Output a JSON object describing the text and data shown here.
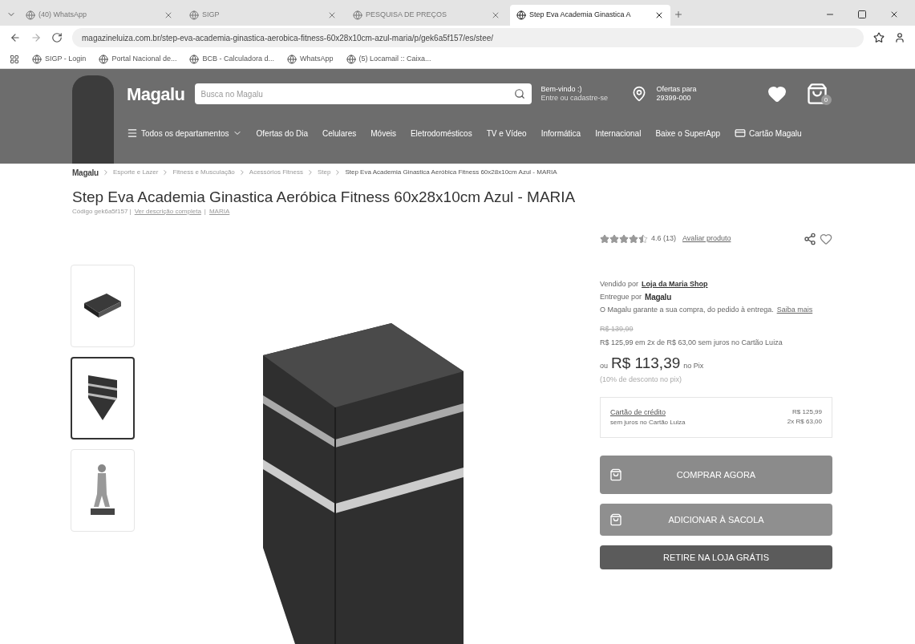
{
  "browser": {
    "tabs": [
      {
        "title": "(40) WhatsApp",
        "selected": false
      },
      {
        "title": "SIGP",
        "selected": false
      },
      {
        "title": "PESQUISA DE PREÇOS",
        "selected": false
      },
      {
        "title": "Step Eva Academia Ginastica A",
        "selected": true
      }
    ],
    "url": "magazineluiza.com.br/step-eva-academia-ginastica-aerobica-fitness-60x28x10cm-azul-maria/p/gek6a5f157/es/stee/",
    "bookmarks": [
      "SIGP - Login",
      "Portal Nacional de...",
      "BCB - Calculadora d...",
      "WhatsApp",
      "(5) Locamail :: Caixa..."
    ]
  },
  "header": {
    "logo": "Magalu",
    "search_placeholder": "Busca no Magalu",
    "greeting": "Bem-vindo :)",
    "greeting_sub": "Entre ou cadastre-se",
    "location_label": "Ofertas para",
    "zip": "29399-000",
    "cart_count": "0",
    "nav": [
      "Todos os departamentos",
      "Ofertas do Dia",
      "Celulares",
      "Móveis",
      "Eletrodomésticos",
      "TV e Vídeo",
      "Informática",
      "Internacional",
      "Baixe o SuperApp",
      "Cartão Magalu"
    ]
  },
  "breadcrumb": {
    "logo": "Magalu",
    "items": [
      "Esporte e Lazer",
      "Fitness e Musculação",
      "Acessórios Fitness",
      "Step",
      "Step Eva Academia Ginastica Aeróbica Fitness 60x28x10cm Azul - MARIA"
    ]
  },
  "product": {
    "title": "Step Eva Academia Ginastica Aeróbica Fitness 60x28x10cm Azul - MARIA",
    "code": "Código gek6a5f157 |",
    "separator": "|",
    "description_link": "Ver descrição completa",
    "brand_link": "MARIA",
    "thumbnails": [
      {
        "kind": "flat",
        "selected": false
      },
      {
        "kind": "stack",
        "selected": true
      },
      {
        "kind": "person",
        "selected": false
      }
    ]
  },
  "buy_box": {
    "stars": 4.5,
    "rating": "4.6 (13)",
    "rate_link": "Avaliar produto",
    "seller_label": "Vendido por",
    "seller": "Loja da Maria Shop",
    "delivery_label": "Entregue por",
    "delivery_logo": "Magalu",
    "guarantee": "O Magalu garante a sua compra, do pedido à entrega.",
    "guarantee_link": "Saiba mais",
    "old_price": "R$ 139,99",
    "installments": "R$ 125,99 em 2x de R$ 63,00 sem juros no Cartão Luiza",
    "pix_prefix": "ou",
    "pix_price": "R$ 113,39",
    "pix_suffix": "no Pix",
    "pix_discount": "(10% de desconto no pix)",
    "payment": {
      "title": "Cartão de crédito",
      "subtitle": "sem juros no Cartão Luiza",
      "total": "R$ 125,99",
      "split": "2x R$ 63,00"
    },
    "buttons": [
      {
        "kind": "buy",
        "label": "COMPRAR AGORA"
      },
      {
        "kind": "bag",
        "label": "ADICIONAR À SACOLA"
      },
      {
        "kind": "store",
        "label": "RETIRE NA LOJA GRÁTIS"
      }
    ]
  }
}
